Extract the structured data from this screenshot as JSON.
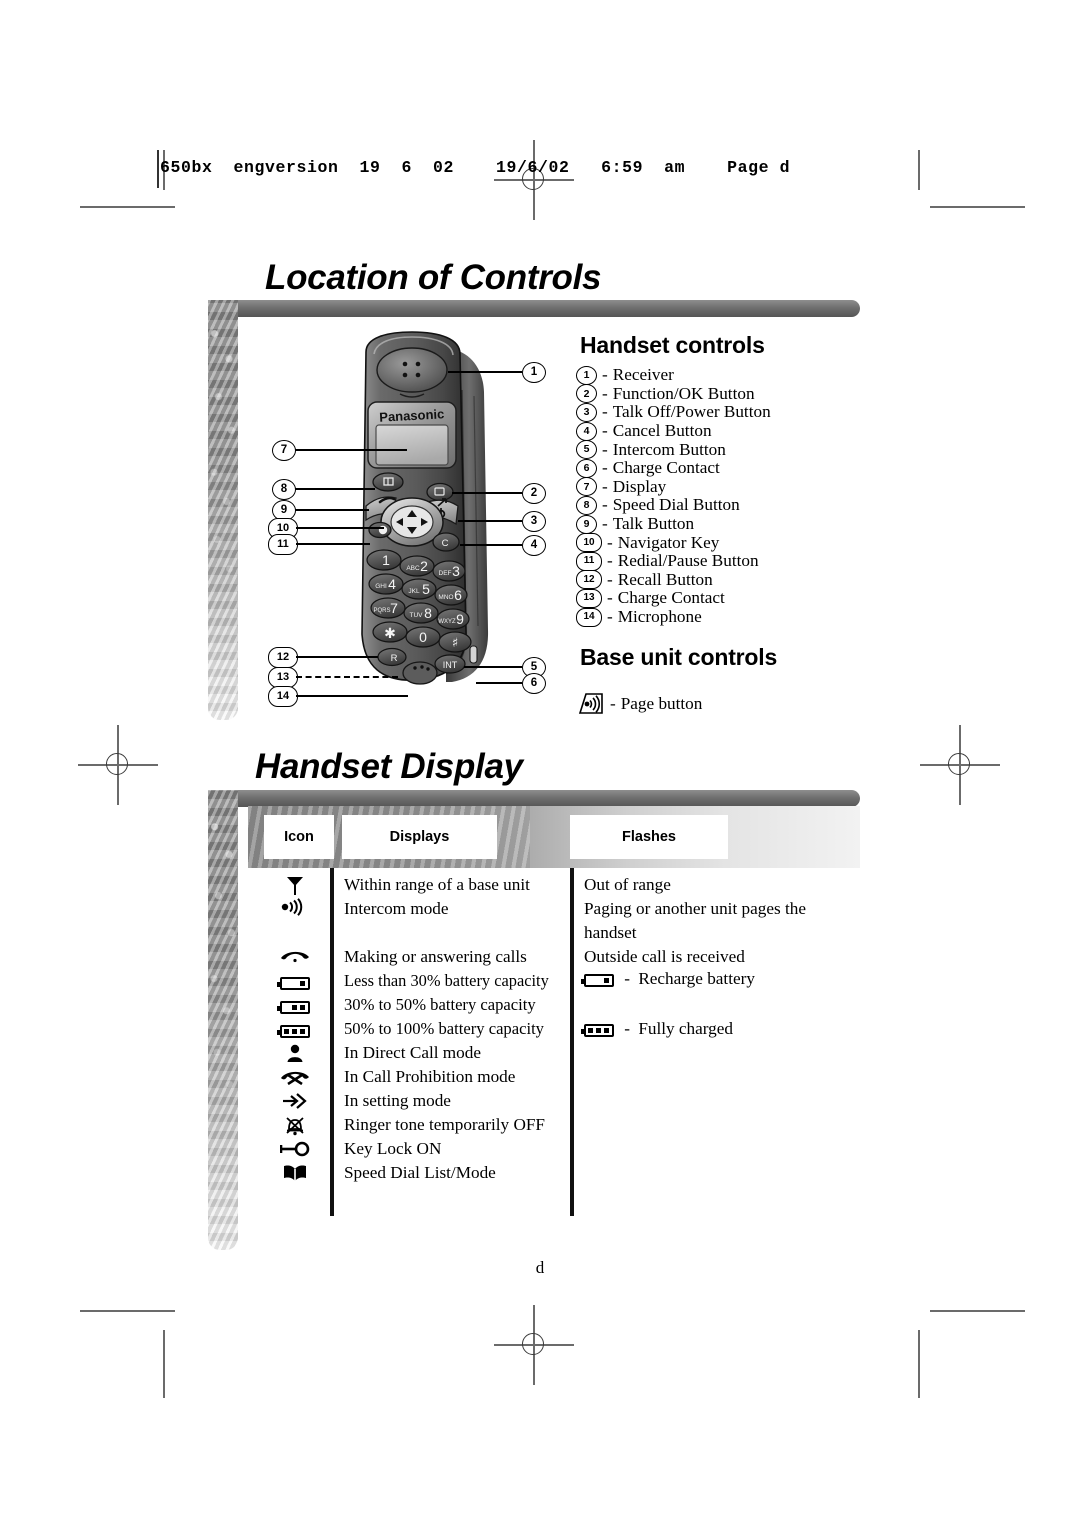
{
  "page": {
    "slug": "650bx  engversion  19  6  02    19/6/02   6:59  am    Page d",
    "footer": "d"
  },
  "sections": {
    "location_title": "Location of Controls",
    "display_title": "Handset Display"
  },
  "handset_controls": {
    "heading": "Handset controls",
    "items": [
      {
        "num": "1",
        "label": "Receiver"
      },
      {
        "num": "2",
        "label": "Function/OK Button"
      },
      {
        "num": "3",
        "label": "Talk Off/Power Button"
      },
      {
        "num": "4",
        "label": "Cancel Button"
      },
      {
        "num": "5",
        "label": "Intercom Button"
      },
      {
        "num": "6",
        "label": "Charge Contact"
      },
      {
        "num": "7",
        "label": "Display"
      },
      {
        "num": "8",
        "label": "Speed Dial Button"
      },
      {
        "num": "9",
        "label": "Talk Button"
      },
      {
        "num": "10",
        "label": "Navigator Key"
      },
      {
        "num": "11",
        "label": "Redial/Pause Button"
      },
      {
        "num": "12",
        "label": "Recall Button"
      },
      {
        "num": "13",
        "label": "Charge Contact"
      },
      {
        "num": "14",
        "label": "Microphone"
      }
    ],
    "dash": "-"
  },
  "base_unit_controls": {
    "heading": "Base unit controls",
    "page_button": {
      "icon": "page-speaker-icon",
      "dash": "-",
      "label": "Page button"
    }
  },
  "phone_illustration": {
    "brand": "Panasonic",
    "keys": [
      {
        "sub": "",
        "main": "1"
      },
      {
        "sub": "ABC",
        "main": "2"
      },
      {
        "sub": "DEF",
        "main": "3"
      },
      {
        "sub": "GHI",
        "main": "4"
      },
      {
        "sub": "JKL",
        "main": "5"
      },
      {
        "sub": "MNO",
        "main": "6"
      },
      {
        "sub": "PQRS",
        "main": "7"
      },
      {
        "sub": "TUV",
        "main": "8"
      },
      {
        "sub": "WXYZ",
        "main": "9"
      },
      {
        "sub": "",
        "main": "✱"
      },
      {
        "sub": "",
        "main": "0"
      },
      {
        "sub": "",
        "main": "♯"
      }
    ],
    "recall_key": "R",
    "intercom_key": "INT",
    "cancel_key": "C",
    "left_callouts": [
      "7",
      "8",
      "9",
      "10",
      "11",
      "12",
      "13",
      "14"
    ],
    "right_callouts": [
      "1",
      "2",
      "3",
      "4",
      "5",
      "6"
    ]
  },
  "handset_display_table": {
    "headers": {
      "icon": "Icon",
      "displays": "Displays",
      "flashes": "Flashes"
    },
    "rows": [
      {
        "icon": "antenna-icon",
        "displays": "Within range of a base unit",
        "flashes": "Out of range"
      },
      {
        "icon": "intercom-wave-icon",
        "displays": "Intercom mode",
        "flashes": "Paging or another unit pages the"
      },
      {
        "icon": "",
        "displays": "",
        "flashes": "handset"
      },
      {
        "icon": "handset-icon",
        "displays": "Making or answering calls",
        "flashes": "Outside call is received"
      },
      {
        "icon": "battery-low-icon",
        "displays": "Less than 30% battery capacity",
        "flashes": ""
      },
      {
        "icon": "battery-mid-icon",
        "displays": "30% to 50% battery capacity",
        "flashes": ""
      },
      {
        "icon": "battery-full-icon",
        "displays": "50% to 100% battery capacity",
        "flashes": ""
      },
      {
        "icon": "person-icon",
        "displays": "In Direct Call mode",
        "flashes": ""
      },
      {
        "icon": "call-prohibit-icon",
        "displays": "In Call Prohibition mode",
        "flashes": ""
      },
      {
        "icon": "arrow-setting-icon",
        "displays": "In setting mode",
        "flashes": ""
      },
      {
        "icon": "ringer-off-icon",
        "displays": "Ringer tone temporarily OFF",
        "flashes": ""
      },
      {
        "icon": "key-lock-icon",
        "displays": "Key Lock ON",
        "flashes": ""
      },
      {
        "icon": "speed-dial-book-icon",
        "displays": "Speed Dial List/Mode",
        "flashes": ""
      }
    ],
    "flash_notes": [
      {
        "icon": "battery-low-icon",
        "dash": "-",
        "label": "Recharge battery"
      },
      {
        "icon": "battery-full-icon",
        "dash": "-",
        "label": "Fully charged"
      }
    ]
  }
}
